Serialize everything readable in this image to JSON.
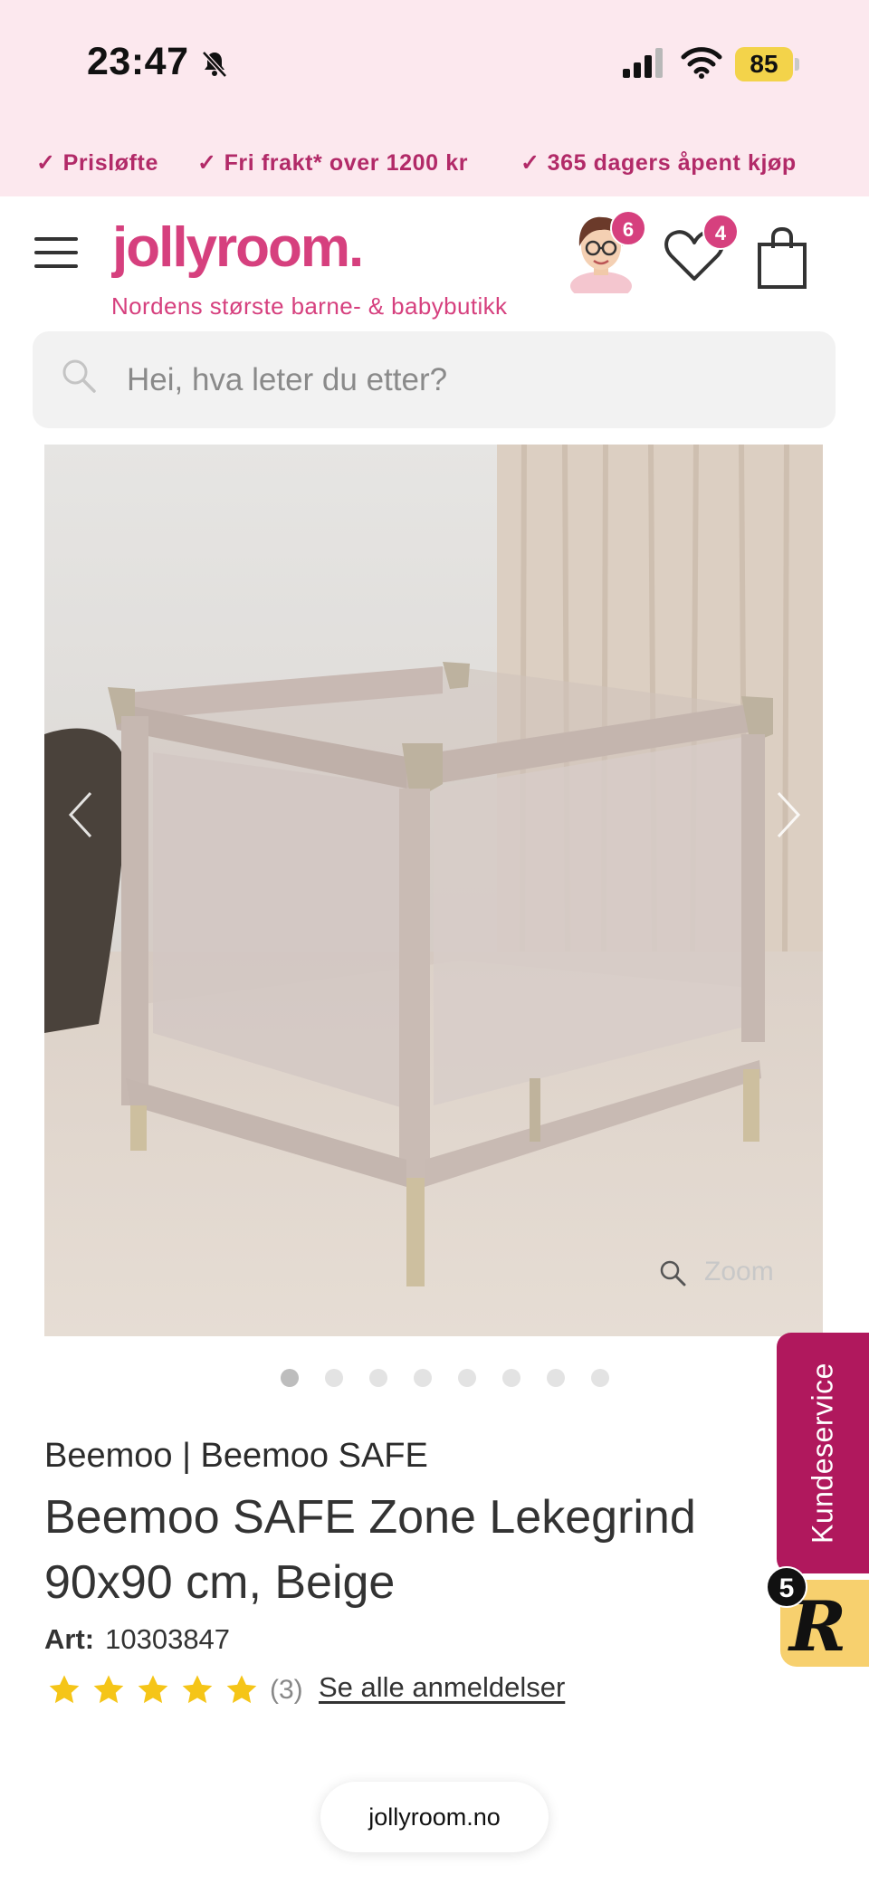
{
  "status_bar": {
    "time": "23:47",
    "battery": "85"
  },
  "promo": [
    {
      "check": "✓",
      "text": "Prisløfte"
    },
    {
      "check": "✓",
      "text": "Fri frakt* over 1200 kr"
    },
    {
      "check": "✓",
      "text": "365 dagers åpent kjøp"
    }
  ],
  "header": {
    "logo": "jollyroom.",
    "tagline": "Nordens største barne- & babybutikk",
    "avatar_badge": "6",
    "wishlist_badge": "4"
  },
  "search": {
    "placeholder": "Hei, hva leter du etter?"
  },
  "gallery": {
    "zoom_label": "Zoom",
    "total_images": 8,
    "active_index": 0
  },
  "product": {
    "brand_line": "Beemoo | Beemoo SAFE",
    "title": "Beemoo SAFE Zone Lekegrind 90x90 cm, Beige",
    "art_label": "Art:",
    "art_number": "10303847",
    "rating": 5,
    "review_count": "(3)",
    "reviews_link": "Se alle anmeldelser"
  },
  "customer_service": {
    "label": "Kundeservice",
    "chat_letter": "R",
    "chat_badge": "5"
  },
  "browser": {
    "url": "jollyroom.no"
  },
  "colors": {
    "brand_pink": "#d6407e",
    "promo_text": "#b22a68",
    "service_tab": "#b0185d",
    "star": "#f5c518",
    "chat_yellow": "#f7d06e"
  }
}
